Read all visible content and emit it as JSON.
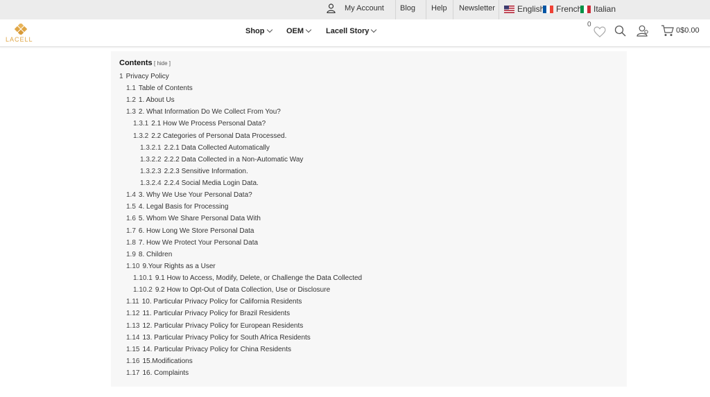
{
  "topbar": {
    "account_label": "My Account",
    "blog_label": "Blog",
    "help_label": "Help",
    "newsletter_label": "Newsletter",
    "languages": [
      {
        "label": "English",
        "flag": "us-flag-icon"
      },
      {
        "label": "French",
        "flag": "fr-flag-icon"
      },
      {
        "label": "Italian",
        "flag": "it-flag-icon"
      }
    ]
  },
  "header": {
    "logo_text": "LACELL",
    "nav": [
      {
        "label": "Shop"
      },
      {
        "label": "OEM"
      },
      {
        "label": "Lacell Story"
      }
    ],
    "wishlist_count": "0",
    "cart_total": "0$0.00",
    "colors": {
      "logo": "#e0a646",
      "topbar_bg": "#ececec"
    }
  },
  "toc": {
    "title": "Contents",
    "hide_label": "[ hide ]",
    "items": [
      {
        "num": "1",
        "text": "Privacy Policy"
      },
      {
        "num": "1.1",
        "text": "Table of Contents"
      },
      {
        "num": "1.2",
        "text": "1. About Us"
      },
      {
        "num": "1.3",
        "text": "2. What Information Do We Collect From You?"
      },
      {
        "num": "1.3.1",
        "text": "2.1 How We Process Personal Data?"
      },
      {
        "num": "1.3.2",
        "text": "2.2 Categories of Personal Data Processed."
      },
      {
        "num": "1.3.2.1",
        "text": "2.2.1 Data Collected Automatically"
      },
      {
        "num": "1.3.2.2",
        "text": "2.2.2 Data Collected in a Non-Automatic Way"
      },
      {
        "num": "1.3.2.3",
        "text": "2.2.3 Sensitive Information."
      },
      {
        "num": "1.3.2.4",
        "text": "2.2.4 Social Media Login Data."
      },
      {
        "num": "1.4",
        "text": "3. Why We Use Your Personal Data?"
      },
      {
        "num": "1.5",
        "text": "4. Legal Basis for Processing"
      },
      {
        "num": "1.6",
        "text": "5. Whom We Share Personal Data With"
      },
      {
        "num": "1.7",
        "text": "6. How Long We Store Personal Data"
      },
      {
        "num": "1.8",
        "text": "7. How We Protect Your Personal Data"
      },
      {
        "num": "1.9",
        "text": "8. Children"
      },
      {
        "num": "1.10",
        "text": "9.Your Rights as a User"
      },
      {
        "num": "1.10.1",
        "text": "9.1 How to Access, Modify, Delete, or Challenge the Data Collected"
      },
      {
        "num": "1.10.2",
        "text": "9.2 How to Opt-Out of Data Collection, Use or Disclosure"
      },
      {
        "num": "1.11",
        "text": "10. Particular Privacy Policy for California Residents"
      },
      {
        "num": "1.12",
        "text": "11. Particular Privacy Policy for Brazil Residents"
      },
      {
        "num": "1.13",
        "text": "12. Particular Privacy Policy for European Residents"
      },
      {
        "num": "1.14",
        "text": "13. Particular Privacy Policy for South Africa Residents"
      },
      {
        "num": "1.15",
        "text": "14. Particular Privacy Policy for China Residents"
      },
      {
        "num": "1.16",
        "text": "15.Modifications"
      },
      {
        "num": "1.17",
        "text": "16. Complaints"
      }
    ]
  }
}
